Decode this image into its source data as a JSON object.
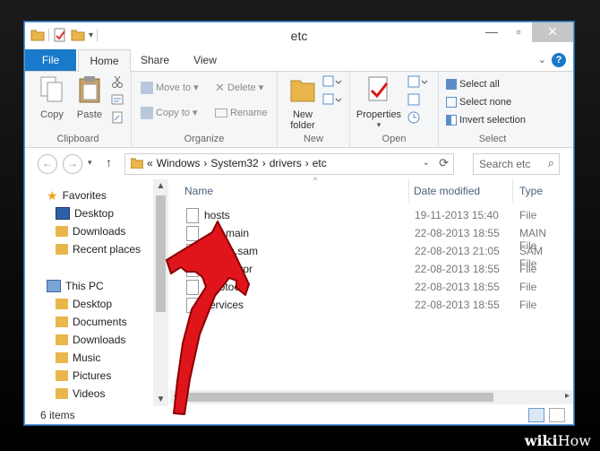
{
  "window": {
    "title": "etc"
  },
  "tabs": {
    "file": "File",
    "home": "Home",
    "share": "Share",
    "view": "View"
  },
  "ribbon": {
    "clipboard": {
      "label": "Clipboard",
      "copy": "Copy",
      "paste": "Paste"
    },
    "organize": {
      "label": "Organize",
      "move_to": "Move to",
      "copy_to": "Copy to",
      "delete": "Delete",
      "rename": "Rename"
    },
    "new": {
      "label": "New",
      "new_folder_line1": "New",
      "new_folder_line2": "folder"
    },
    "open": {
      "label": "Open",
      "properties": "Properties"
    },
    "select": {
      "label": "Select",
      "select_all": "Select all",
      "select_none": "Select none",
      "invert": "Invert selection"
    }
  },
  "address": {
    "prefix": "«",
    "crumbs": [
      "Windows",
      "System32",
      "drivers",
      "etc"
    ]
  },
  "search": {
    "placeholder": "Search etc"
  },
  "nav": {
    "favorites": "Favorites",
    "desktop": "Desktop",
    "downloads": "Downloads",
    "recent": "Recent places",
    "this_pc": "This PC",
    "pc_desktop": "Desktop",
    "documents": "Documents",
    "pc_downloads": "Downloads",
    "music": "Music",
    "pictures": "Pictures",
    "videos": "Videos"
  },
  "columns": {
    "name": "Name",
    "date": "Date modified",
    "type": "Type"
  },
  "files": [
    {
      "name": "hosts",
      "date": "19-11-2013 15:40",
      "type": "File"
    },
    {
      "name": "lmhosts.sam",
      "shown": "main",
      "date": "22-08-2013 18:55",
      "type": "MAIN File"
    },
    {
      "name": "lmhosts.sam",
      "shown": "s.sam",
      "date": "22-08-2013 21:05",
      "type": "SAM File"
    },
    {
      "name": "networks",
      "shown": "networ",
      "date": "22-08-2013 18:55",
      "type": "File"
    },
    {
      "name": "protocol",
      "shown": "protoco",
      "date": "22-08-2013 18:55",
      "type": "File"
    },
    {
      "name": "services",
      "date": "22-08-2013 18:55",
      "type": "File"
    }
  ],
  "status": {
    "count": "6 items"
  },
  "watermark": {
    "wiki": "wiki",
    "how": "How"
  },
  "colors": {
    "accent": "#1979ca",
    "arrow": "#e0141b",
    "frame": "#000000"
  }
}
